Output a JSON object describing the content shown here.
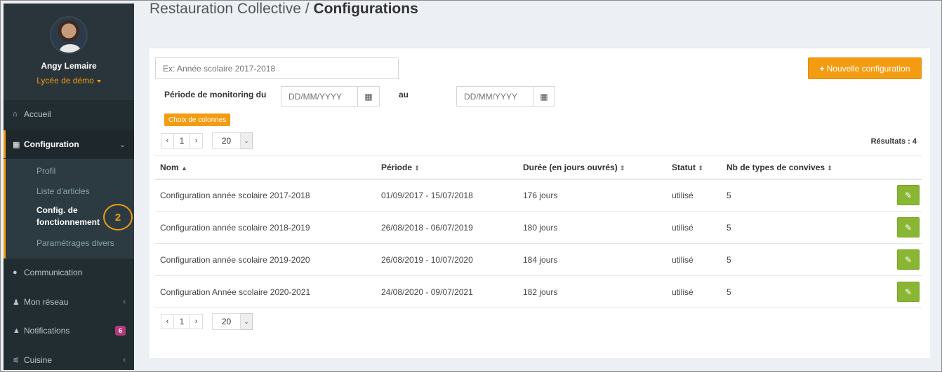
{
  "header": {
    "section": "Restauration Collective / ",
    "title": "Configurations"
  },
  "user": {
    "name": "Angy Lemaire",
    "school": "Lycée de démo"
  },
  "nav": {
    "accueil": "Accueil",
    "configuration": "Configuration",
    "submenu": [
      "Profil",
      "Liste d'articles",
      "Config. de",
      "fonctionnement",
      "Paramétrages divers"
    ],
    "step_marker": "2",
    "communication": "Communication",
    "reseau": "Mon réseau",
    "notifications": "Notifications",
    "notifications_count": "6",
    "cuisine": "Cuisine"
  },
  "filters": {
    "search_placeholder": "Ex: Année scolaire 2017-2018",
    "period_label": "Période de monitoring du",
    "to_label": "au",
    "date_placeholder": "DD/MM/YYYY",
    "columns_button": "Choix de colonnes"
  },
  "new_button": "Nouvelle configuration",
  "pagination": {
    "prev": "‹",
    "page": "1",
    "next": "›",
    "page_size": "20"
  },
  "results_label": "Résultats : 4",
  "table": {
    "headers": [
      "Nom",
      "Période",
      "Durée (en jours ouvrés)",
      "Statut",
      "Nb de types de convives"
    ],
    "rows": [
      [
        "Configuration année scolaire 2017-2018",
        "01/09/2017 - 15/07/2018",
        "176 jours",
        "utilisé",
        "5"
      ],
      [
        "Configuration année scolaire 2018-2019",
        "26/08/2018 - 06/07/2019",
        "180 jours",
        "utilisé",
        "5"
      ],
      [
        "Configuration année scolaire 2019-2020",
        "26/08/2019 - 10/07/2020",
        "184 jours",
        "utilisé",
        "5"
      ],
      [
        "Configuration Année scolaire 2020-2021",
        "24/08/2020 - 09/07/2021",
        "182 jours",
        "utilisé",
        "5"
      ]
    ]
  },
  "colors": {
    "accent": "#f39c12",
    "sidebar": "#222d32",
    "edit": "#8ab733"
  }
}
